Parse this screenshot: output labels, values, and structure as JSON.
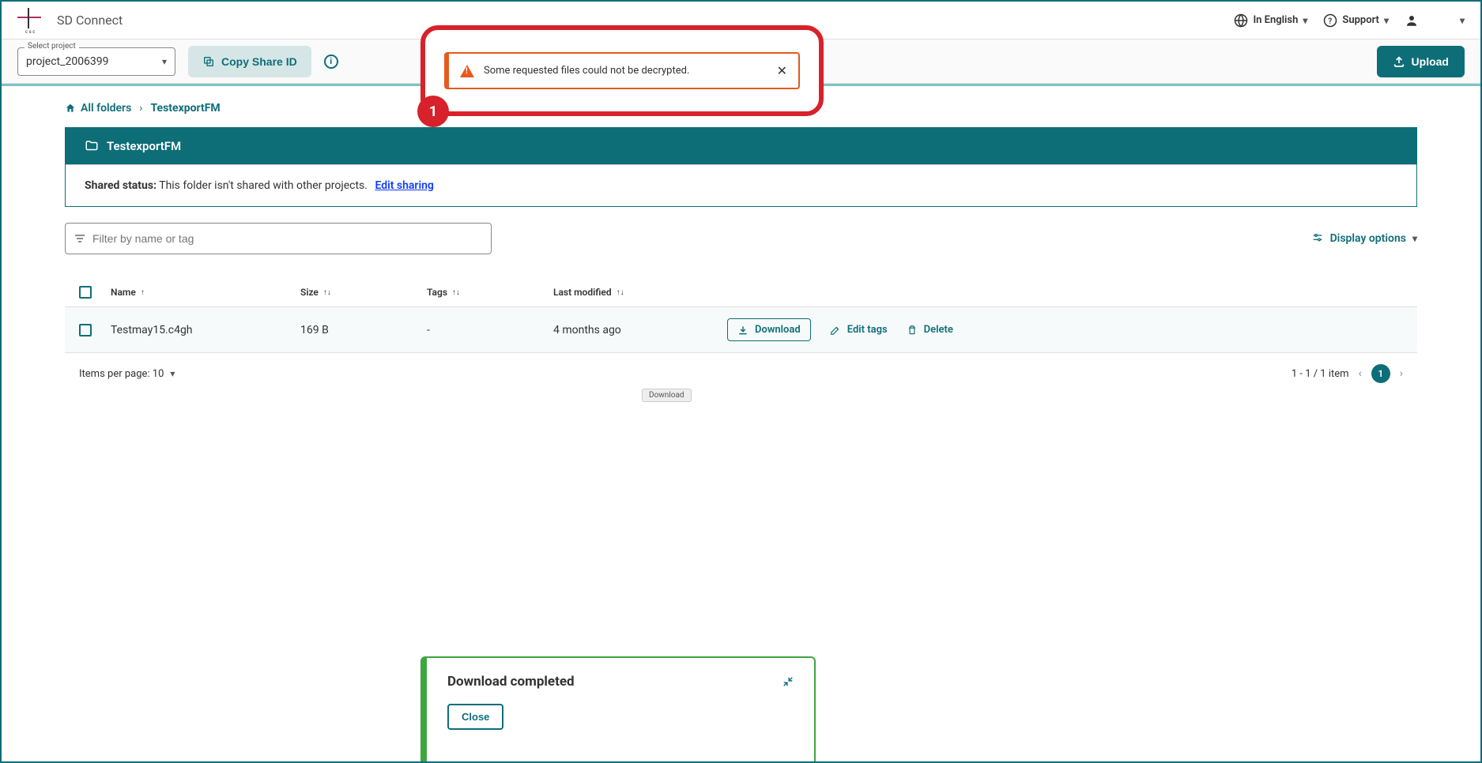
{
  "header": {
    "app_title": "SD Connect",
    "language": "In English",
    "support": "Support"
  },
  "toolbar": {
    "select_label": "Select project",
    "project_value": "project_2006399",
    "copy_share": "Copy Share ID",
    "upload": "Upload"
  },
  "breadcrumb": {
    "home": "All folders",
    "current": "TestexportFM"
  },
  "folder": {
    "name": "TestexportFM",
    "shared_label": "Shared status:",
    "shared_text": " This folder isn't shared with other projects.",
    "edit_sharing": "Edit sharing"
  },
  "filter": {
    "placeholder": "Filter by name or tag",
    "display_options": "Display options"
  },
  "table": {
    "headers": {
      "name": "Name",
      "size": "Size",
      "tags": "Tags",
      "modified": "Last modified"
    },
    "row": {
      "name": "Testmay15.c4gh",
      "size": "169 B",
      "tags": "-",
      "modified": "4 months ago",
      "download": "Download",
      "edit_tags": "Edit tags",
      "delete": "Delete"
    }
  },
  "pagination": {
    "items_per_page": "Items per page: 10",
    "range": "1 - 1 / 1 item",
    "page": "1"
  },
  "alert": {
    "text": "Some requested files could not be decrypted.",
    "badge": "1"
  },
  "tooltip": {
    "download": "Download"
  },
  "toast": {
    "title": "Download completed",
    "close": "Close"
  }
}
